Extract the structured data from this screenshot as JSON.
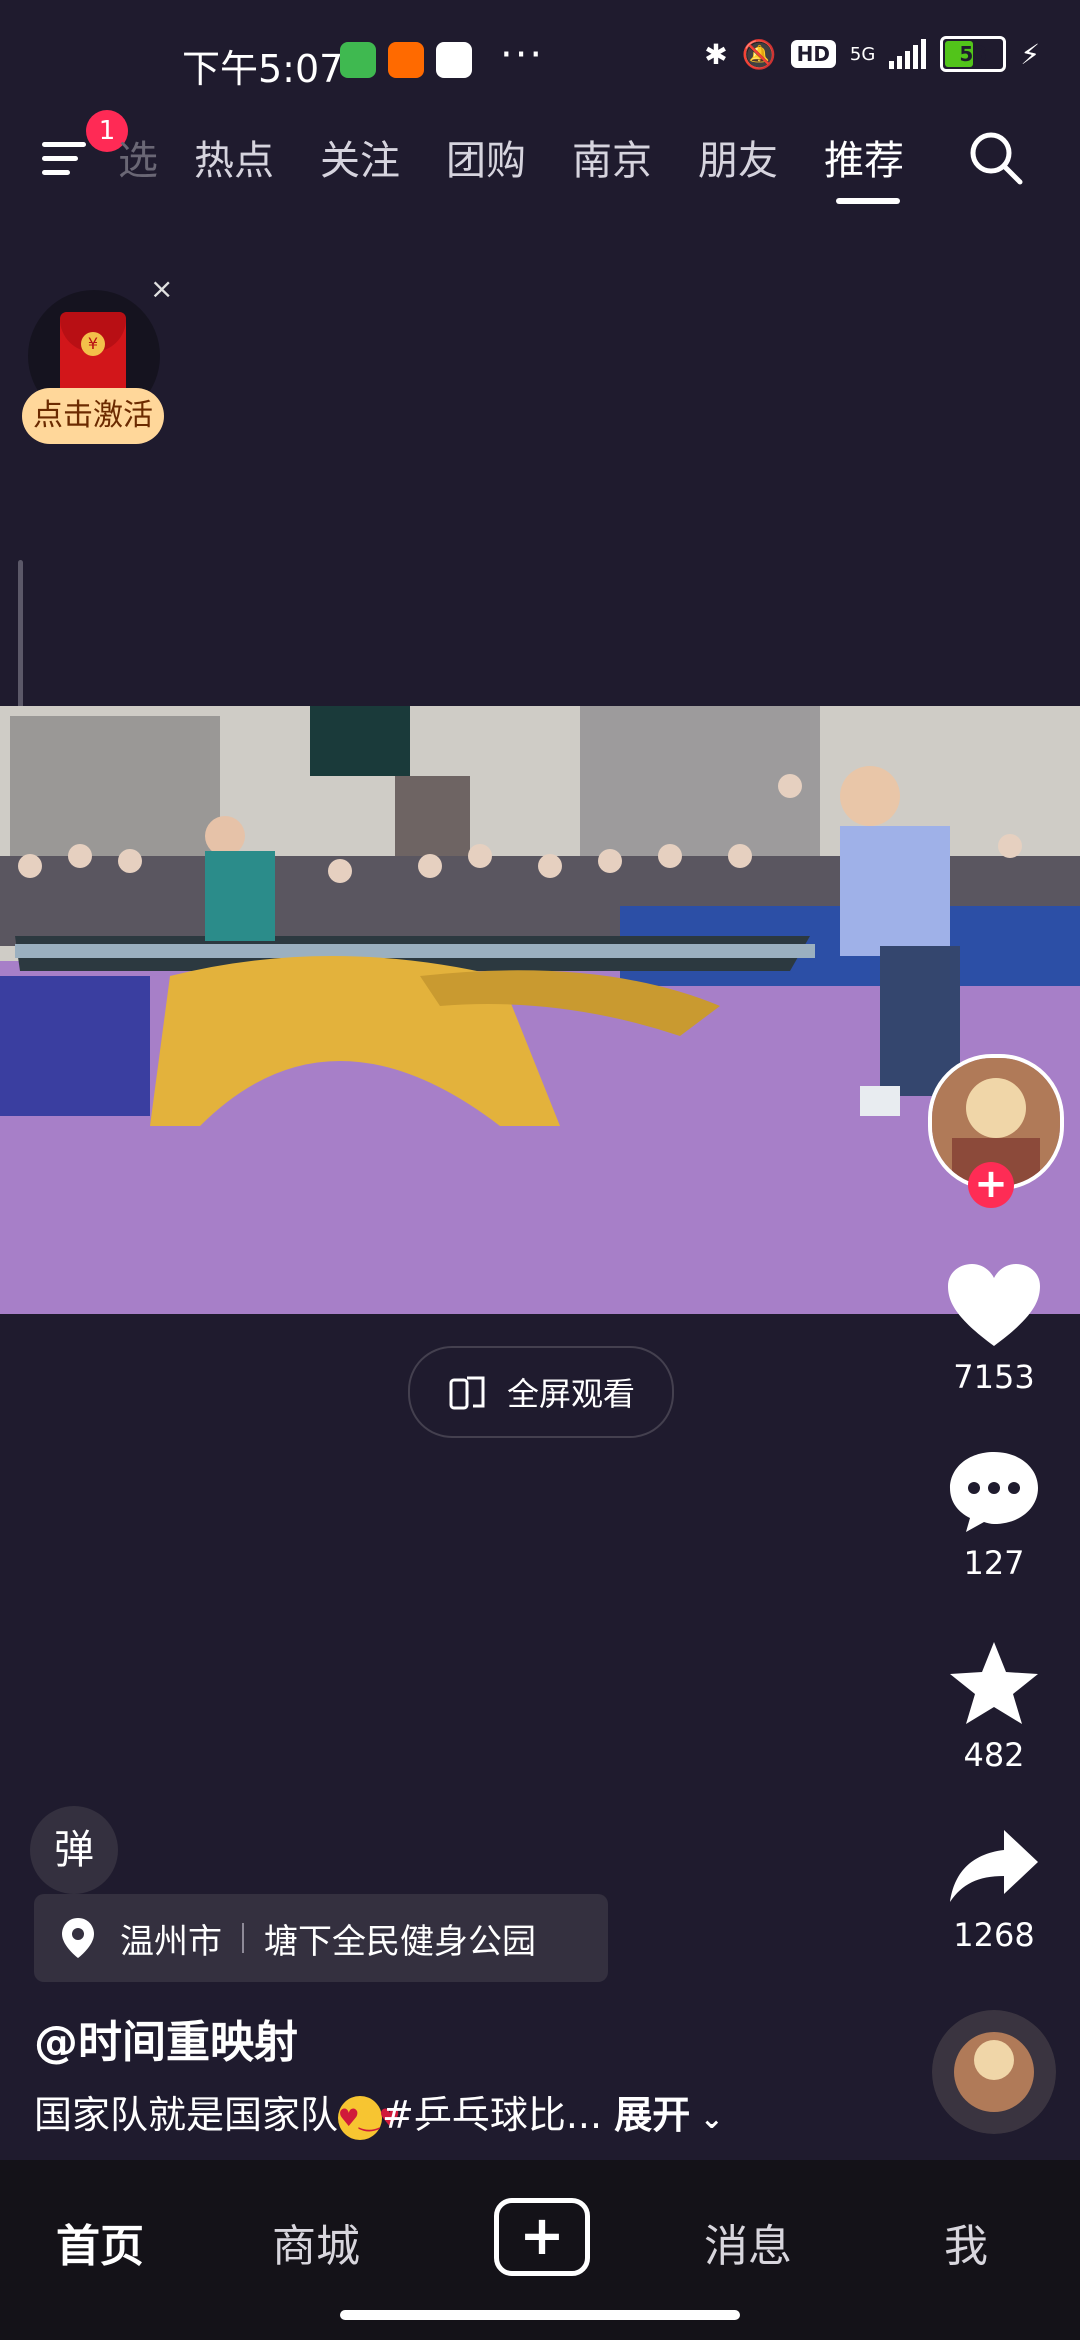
{
  "status_bar": {
    "time": "下午5:07",
    "overflow_dots": "···",
    "hd": "HD",
    "network": "5G",
    "battery": "53",
    "battery_level": 0.53
  },
  "top_nav": {
    "menu_badge": "1",
    "tabs": [
      {
        "label": "热点"
      },
      {
        "label": "关注"
      },
      {
        "label": "团购"
      },
      {
        "label": "南京"
      },
      {
        "label": "朋友"
      },
      {
        "label": "推荐"
      }
    ],
    "partial_tab": "选",
    "active_tab": "推荐"
  },
  "promo": {
    "label": "点击激活",
    "close": "×",
    "coin": "¥"
  },
  "video": {
    "fullscreen_label": "全屏观看"
  },
  "actions": {
    "like_count": "7153",
    "comment_count": "127",
    "favorite_count": "482",
    "share_count": "1268",
    "follow_plus": "+"
  },
  "post": {
    "danmu_label": "弹",
    "location_city": "温州市",
    "location_place": "塘下全民健身公园",
    "author": "@时间重映射",
    "caption": "国家队就是国家队",
    "caption_tail": "#乒乓球比...",
    "expand": "展开"
  },
  "bottom_nav": {
    "home": "首页",
    "mall": "商城",
    "add": "+",
    "messages": "消息",
    "me": "我"
  }
}
